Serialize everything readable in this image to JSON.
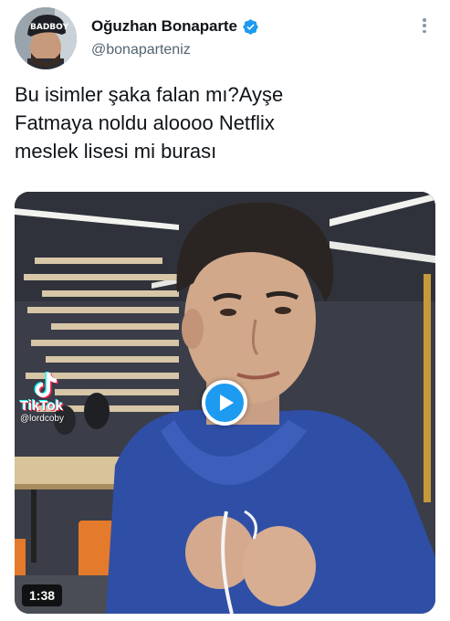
{
  "author": {
    "display_name": "Oğuzhan Bonaparte",
    "handle": "@bonaparteniz",
    "verified": true,
    "avatar_text": "BADBOY"
  },
  "tweet": {
    "text": "Bu isimler şaka falan mı?Ayşe\nFatmaya noldu aloooo Netflix\nmeslek lisesi mi burası"
  },
  "media": {
    "type": "video",
    "duration": "1:38",
    "watermark": {
      "brand": "TikTok",
      "user": "@lordcoby"
    },
    "play_icon": "play-icon"
  },
  "colors": {
    "accent": "#1d9bf0",
    "text": "#0f1419",
    "secondary": "#536471"
  }
}
